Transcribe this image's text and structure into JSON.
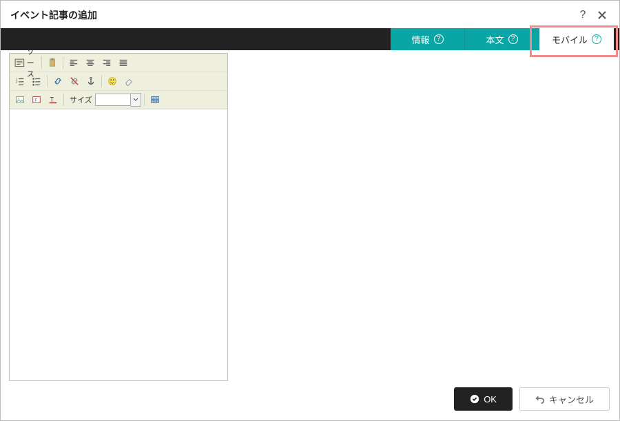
{
  "dialog": {
    "title": "イベント記事の追加"
  },
  "tabs": {
    "info": "情報",
    "body": "本文",
    "mobile": "モバイル"
  },
  "editor": {
    "source_label": "ソース",
    "size_label": "サイズ",
    "size_value": ""
  },
  "footer": {
    "ok": "OK",
    "cancel": "キャンセル"
  }
}
